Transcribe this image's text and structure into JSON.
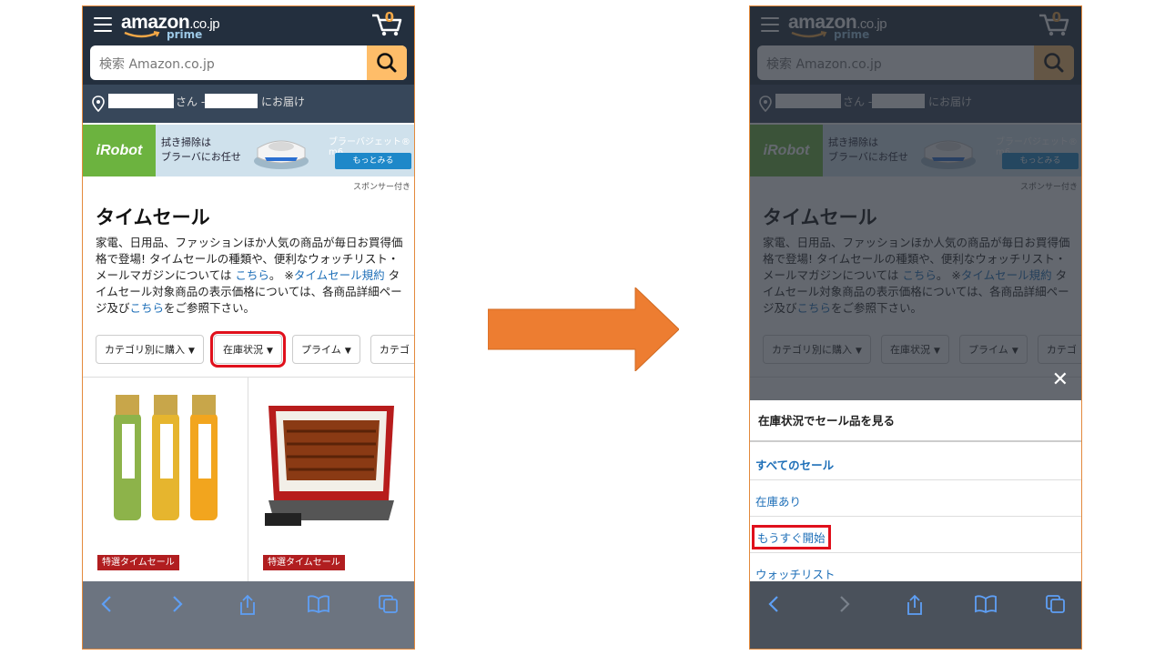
{
  "left_phone": {
    "logo": "amazon",
    "logo_suffix": ".co.jp",
    "prime": "prime",
    "cart_count": "0",
    "search_placeholder": "検索 Amazon.co.jp",
    "deliver_san": "さん -",
    "deliver_text": "にお届け",
    "banner_brand": "iRobot",
    "banner_line1": "拭き掃除は",
    "banner_line2": "ブラーバにお任せ",
    "banner_product": "ブラーバジェット® m6",
    "banner_button": "もっとみる",
    "sponsor": "スポンサー付き",
    "title": "タイムセール",
    "desc_1": "家電、日用品、ファッションほか人気の商品が毎日お買得価格で登場! タイムセールの種類や、便利なウォッチリスト・メールマガジンについては ",
    "desc_link1": "こちら",
    "desc_2": "。 ※",
    "desc_link2": "タイムセール規約",
    "desc_3": " タイムセール対象商品の表示価格については、各商品詳細ページ及び",
    "desc_link3": "こちら",
    "desc_4": "をご参照下さい。",
    "filters": [
      "カテゴリ別に購入",
      "在庫状況",
      "プライム",
      "カテゴ"
    ],
    "badge_1": "特選タイムセール",
    "badge_2": "特選タイムセール"
  },
  "right_phone": {
    "sheet_title": "在庫状況でセール品を見る",
    "options": [
      "すべてのセール",
      "在庫あり",
      "もうすぐ開始",
      "ウォッチリスト"
    ],
    "close": "✕"
  },
  "colors": {
    "header": "#232f3e",
    "accent": "#febd69",
    "link": "#1e6fb8",
    "highlight": "#e0101c",
    "arrow": "#ed7d31"
  }
}
